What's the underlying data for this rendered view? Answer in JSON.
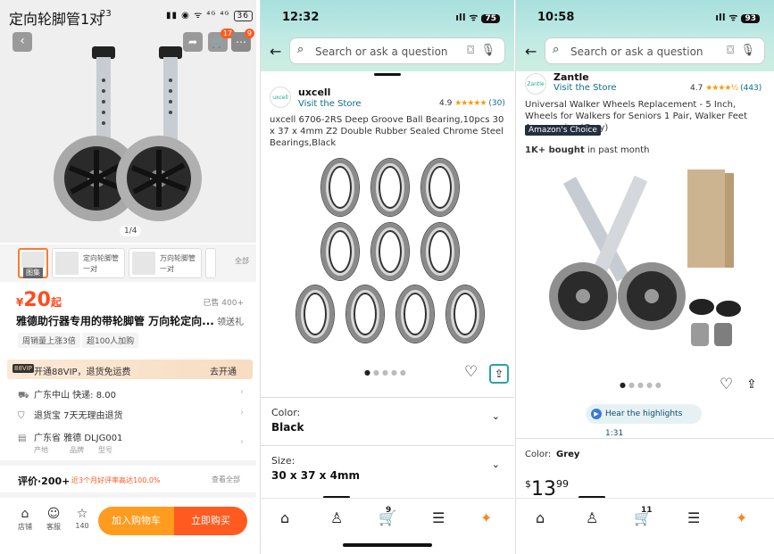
{
  "panel1": {
    "status": {
      "title_overlay": "定向轮脚管1对",
      "time": "23",
      "battery": "36"
    },
    "image_counter": "1/4",
    "thumbnails": [
      {
        "label": "图集"
      },
      {
        "label": "定向轮脚管一对"
      },
      {
        "label": "万向轮脚管一对"
      }
    ],
    "more_label": "全部",
    "price": {
      "currency": "¥",
      "amount": "20",
      "suffix": "起"
    },
    "sold": "已售 400+",
    "product_name": "雅德助行器专用的带轮脚管 万向轮定向...",
    "gift": "领送礼",
    "tags": [
      "周销量上涨3倍",
      "超100人加购"
    ],
    "vip": {
      "logo": "88VIP",
      "text": "开通88VIP，退货免运费",
      "action": "去开通"
    },
    "rows": [
      {
        "icon": "truck-icon",
        "text": "广东中山  快递: 8.00"
      },
      {
        "icon": "shield-icon",
        "text": "退货宝  7天无理由退货"
      },
      {
        "icon": "doc-icon",
        "text": "广东省    雅德    DLJG001",
        "sub": [
          "产地",
          "品牌",
          "型号"
        ]
      }
    ],
    "review": {
      "title": "评价·200+",
      "sub": "近3个月好评率高达100.0%",
      "all": "查看全部"
    },
    "bottom": {
      "icons": [
        {
          "label": "店铺"
        },
        {
          "label": "客服"
        },
        {
          "label": "140"
        }
      ],
      "cart": "加入购物车",
      "buy": "立即购买"
    }
  },
  "panel2": {
    "time": "12:32",
    "battery": "75",
    "search_placeholder": "Search or ask a question",
    "brand": "uxcell",
    "visit": "Visit the Store",
    "rating": "4.9",
    "stars": "★★★★★",
    "rating_count": "(30)",
    "title": "uxcell 6706-2RS Deep Groove Ball Bearing,10pcs 30 x 37 x 4mm Z2 Double Rubber Sealed Chrome Steel Bearings,Black",
    "options": [
      {
        "label": "Color:",
        "value": "Black"
      },
      {
        "label": "Size:",
        "value": "30 x 37 x 4mm"
      }
    ],
    "cart_count": "9"
  },
  "panel3": {
    "time": "10:58",
    "battery": "93",
    "search_placeholder": "Search or ask a question",
    "brand": "Zantle",
    "visit": "Visit the Store",
    "rating": "4.7",
    "stars": "★★★★½",
    "rating_count": "(443)",
    "title": "Universal Walker Wheels Replacement - 5 Inch, Wheels for Walkers for Seniors 1 Pair, Walker Feet Accessories (Grey)",
    "badge": "Amazon's Choice",
    "bought_bold": "1K+ bought",
    "bought_rest": " in past month",
    "highlights": "Hear the highlights 1:31",
    "color_label": "Color:",
    "color_value": "Grey",
    "price_symbol": "$",
    "price_whole": "13",
    "price_frac": "99",
    "cart_count": "11"
  }
}
